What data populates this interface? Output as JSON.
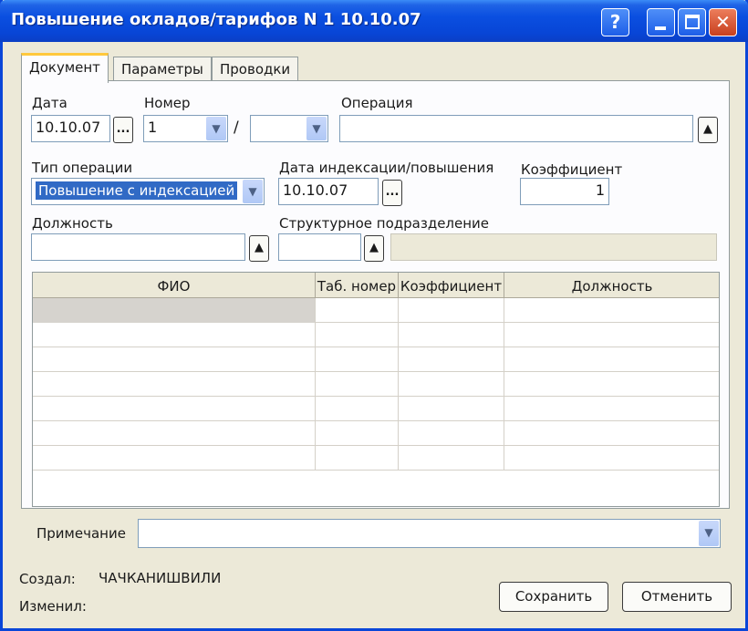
{
  "window": {
    "title": "Повышение окладов/тарифов N 1 10.10.07"
  },
  "tabs": [
    "Документ",
    "Параметры",
    "Проводки"
  ],
  "form": {
    "date_label": "Дата",
    "date_value": "10.10.07",
    "ellipsis": "...",
    "number_label": "Номер",
    "number_value": "1",
    "number_sep": "/",
    "number_suffix": "",
    "operation_label": "Операция",
    "operation_value": "",
    "optype_label": "Тип операции",
    "optype_value": "Повышение с индексацией",
    "index_date_label": "Дата индексации/повышения",
    "index_date_value": "10.10.07",
    "coef_label": "Коэффициент",
    "coef_value": "1",
    "position_label": "Должность",
    "position_value": "",
    "unit_label": "Структурное подразделение",
    "unit_code": "",
    "unit_name": ""
  },
  "grid": {
    "columns": [
      "ФИО",
      "Таб. номер",
      "Коэффициент",
      "Должность"
    ],
    "rows": [
      [
        "",
        "",
        "",
        ""
      ],
      [
        "",
        "",
        "",
        ""
      ],
      [
        "",
        "",
        "",
        ""
      ],
      [
        "",
        "",
        "",
        ""
      ],
      [
        "",
        "",
        "",
        ""
      ],
      [
        "",
        "",
        "",
        ""
      ],
      [
        "",
        "",
        "",
        ""
      ]
    ]
  },
  "note": {
    "label": "Примечание",
    "value": ""
  },
  "footer": {
    "created_label": "Создал:",
    "created_value": "ЧАЧКАНИШВИЛИ",
    "modified_label": "Изменил:",
    "modified_value": "",
    "save_label": "Сохранить",
    "cancel_label": "Отменить"
  },
  "icons": {
    "help": "question-icon",
    "minimize": "minimize-icon",
    "maximize": "maximize-icon",
    "close": "close-icon",
    "dropdown": "chevron-down-icon",
    "select": "triangle-up-icon"
  },
  "colors": {
    "titlebar": "#0a4fe0",
    "window_bg": "#ece9d8",
    "close_button": "#c8401e",
    "selection": "#316ac5",
    "tab_highlight": "#ffc83c"
  }
}
